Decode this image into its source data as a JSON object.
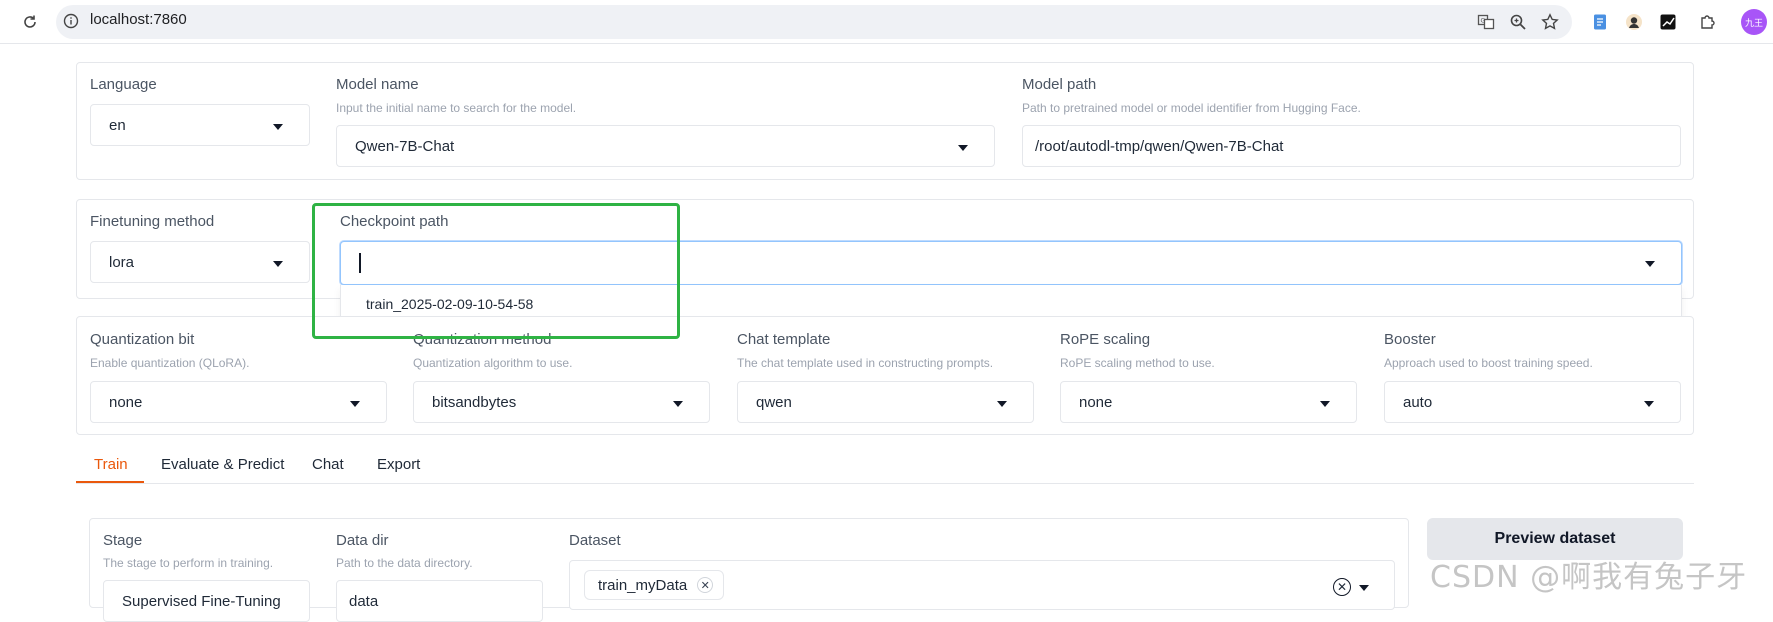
{
  "browser": {
    "url": "localhost:7860",
    "profile_label": "九王"
  },
  "top_row": {
    "language": {
      "label": "Language",
      "value": "en"
    },
    "model_name": {
      "label": "Model name",
      "hint": "Input the initial name to search for the model.",
      "value": "Qwen-7B-Chat"
    },
    "model_path": {
      "label": "Model path",
      "hint": "Path to pretrained model or model identifier from Hugging Face.",
      "value": "/root/autodl-tmp/qwen/Qwen-7B-Chat"
    }
  },
  "second_row": {
    "finetuning_method": {
      "label": "Finetuning method",
      "value": "lora"
    },
    "checkpoint_path": {
      "label": "Checkpoint path",
      "value": "",
      "options": [
        "train_2025-02-09-10-54-58"
      ]
    }
  },
  "third_row": {
    "quantization_bit": {
      "label": "Quantization bit",
      "hint": "Enable quantization (QLoRA).",
      "value": "none"
    },
    "quantization_method": {
      "label": "Quantization method",
      "hint": "Quantization algorithm to use.",
      "value": "bitsandbytes"
    },
    "chat_template": {
      "label": "Chat template",
      "hint": "The chat template used in constructing prompts.",
      "value": "qwen"
    },
    "rope_scaling": {
      "label": "RoPE scaling",
      "hint": "RoPE scaling method to use.",
      "value": "none"
    },
    "booster": {
      "label": "Booster",
      "hint": "Approach used to boost training speed.",
      "value": "auto"
    }
  },
  "tabs": [
    {
      "label": "Train",
      "active": true
    },
    {
      "label": "Evaluate & Predict",
      "active": false
    },
    {
      "label": "Chat",
      "active": false
    },
    {
      "label": "Export",
      "active": false
    }
  ],
  "train": {
    "stage": {
      "label": "Stage",
      "hint": "The stage to perform in training.",
      "value": "Supervised Fine-Tuning"
    },
    "data_dir": {
      "label": "Data dir",
      "hint": "Path to the data directory.",
      "value": "data"
    },
    "dataset": {
      "label": "Dataset",
      "selected": [
        "train_myData"
      ]
    },
    "preview_button": "Preview dataset"
  },
  "watermark": "CSDN @啊我有兔子牙",
  "colors": {
    "accent": "#ea580c",
    "highlight": "#2fb344",
    "focus": "#93c5fd"
  }
}
